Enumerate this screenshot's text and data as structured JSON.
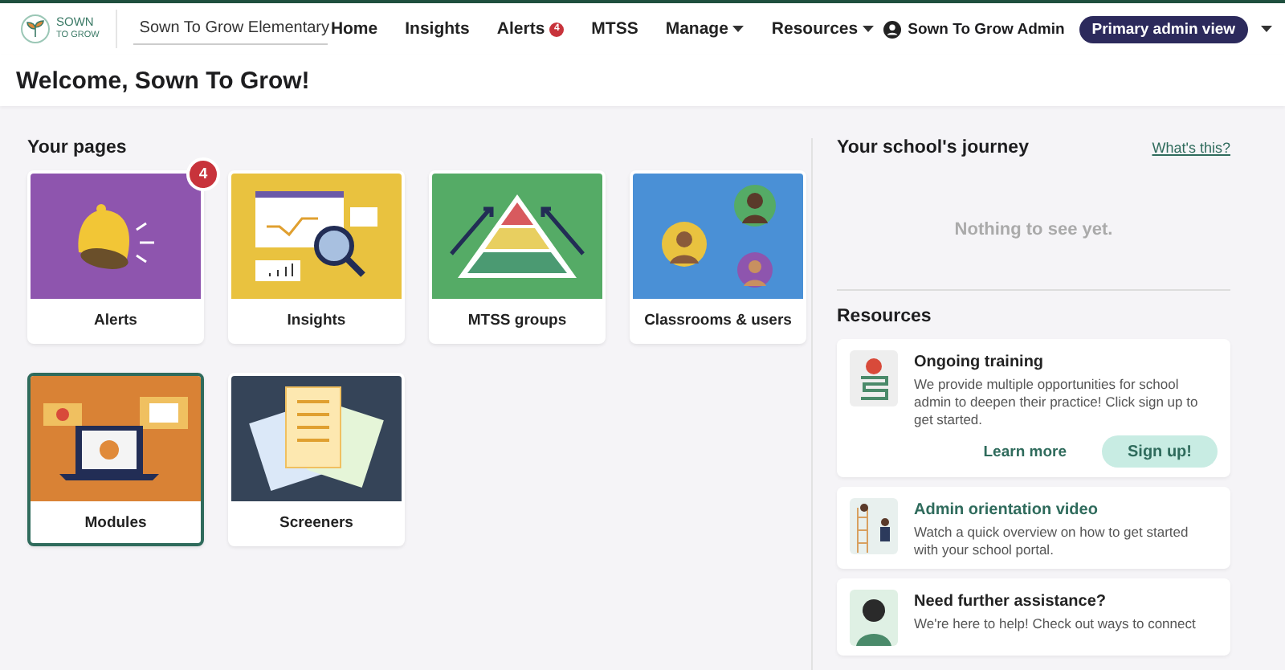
{
  "header": {
    "logo": [
      "SOWN",
      "TO GROW"
    ],
    "school_select": "Sown To Grow Elementary",
    "nav": [
      {
        "label": "Home",
        "kind": "link"
      },
      {
        "label": "Insights",
        "kind": "link"
      },
      {
        "label": "Alerts",
        "kind": "badge",
        "badge": "4"
      },
      {
        "label": "MTSS",
        "kind": "link"
      },
      {
        "label": "Manage",
        "kind": "menu"
      },
      {
        "label": "Resources",
        "kind": "menu"
      }
    ],
    "user": "Sown To Grow Admin",
    "view_button": "Primary admin view"
  },
  "welcome": "Welcome, Sown To Grow!",
  "pages": {
    "title": "Your pages",
    "tiles": [
      {
        "label": "Alerts",
        "kind": "alerts",
        "color": "#8e55ae",
        "badge": "4",
        "selected": false
      },
      {
        "label": "Insights",
        "kind": "insights",
        "color": "#e9c23f",
        "selected": false
      },
      {
        "label": "MTSS groups",
        "kind": "mtss",
        "color": "#55ab66",
        "selected": false
      },
      {
        "label": "Classrooms & users",
        "kind": "classrooms",
        "color": "#4a90d6",
        "selected": false
      },
      {
        "label": "Modules",
        "kind": "modules",
        "color": "#d98235",
        "selected": true
      },
      {
        "label": "Screeners",
        "kind": "screeners",
        "color": "#354458",
        "selected": false
      }
    ]
  },
  "journey": {
    "title": "Your school's journey",
    "link": "What's this?",
    "empty": "Nothing to see yet."
  },
  "resources": {
    "title": "Resources",
    "cards": [
      {
        "kind": "training",
        "title": "Ongoing training",
        "text": "We provide multiple opportunities for school admin to deepen their practice! Click sign up to get started.",
        "secondary": "Learn more",
        "primary": "Sign up!"
      },
      {
        "kind": "video",
        "title": "Admin orientation video",
        "text": "Watch a quick overview on how to get started with your school portal."
      },
      {
        "kind": "help",
        "title": "Need further assistance?",
        "text": "We're here to help! Check out ways to connect"
      }
    ]
  }
}
